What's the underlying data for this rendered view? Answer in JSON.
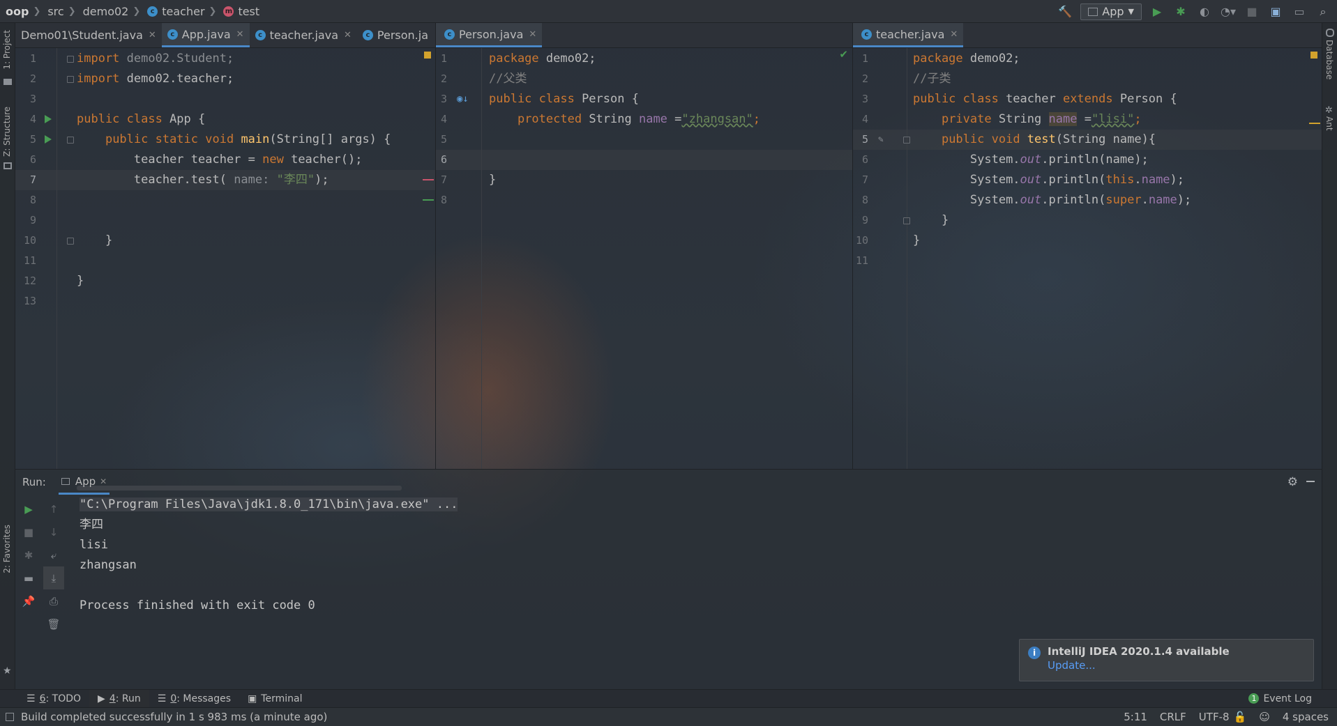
{
  "breadcrumb": [
    "oop",
    "src",
    "demo02",
    "teacher",
    "test"
  ],
  "toolbar": {
    "run_config": "App"
  },
  "left_strip": {
    "project": "1: Project",
    "structure": "Z: Structure",
    "favorites": "2: Favorites"
  },
  "right_strip": {
    "database": "Database",
    "ant": "Ant"
  },
  "left_tabs": [
    {
      "label": "Demo01\\Student.java",
      "active": false
    },
    {
      "label": "App.java",
      "active": true
    },
    {
      "label": "teacher.java",
      "active": false
    },
    {
      "label": "Person.ja",
      "active": false
    }
  ],
  "middle_tabs": [
    {
      "label": "Person.java",
      "active": true
    }
  ],
  "right_tabs": [
    {
      "label": "teacher.java",
      "active": true
    }
  ],
  "editor_app": {
    "line_numbers": [
      "1",
      "2",
      "3",
      "4",
      "5",
      "6",
      "7",
      "8",
      "9",
      "10",
      "11",
      "12",
      "13"
    ],
    "line1": {
      "kw": "import",
      "rest": " demo02.Student;"
    },
    "line2": {
      "kw": "import",
      "rest": " demo02.teacher;"
    },
    "line4": {
      "kw": "public class",
      "rest": " App {"
    },
    "line5": {
      "kw": "public static void",
      "fn": "main",
      "rest": "(String[] args) {"
    },
    "line6": {
      "a": "teacher teacher = ",
      "kw": "new",
      "b": " teacher();"
    },
    "line7": {
      "a": "teacher.test( ",
      "hint": "name:",
      "str": "\"李四\"",
      "b": ");"
    },
    "line10": "}",
    "line12": "}"
  },
  "editor_person": {
    "line_numbers": [
      "1",
      "2",
      "3",
      "4",
      "5",
      "6",
      "7",
      "8"
    ],
    "line1": {
      "kw": "package",
      "rest": " demo02;"
    },
    "line2": "//父类",
    "line3": {
      "kw": "public class",
      "rest": " Person {"
    },
    "line4": {
      "kw": "protected",
      "a": " String ",
      "fld": "name",
      "b": " =",
      "str": "\"zhangsan\"",
      "c": ";"
    },
    "line7": "}"
  },
  "editor_teacher": {
    "line_numbers": [
      "1",
      "2",
      "3",
      "4",
      "5",
      "6",
      "7",
      "8",
      "9",
      "10",
      "11"
    ],
    "line1": {
      "kw": "package",
      "rest": " demo02;"
    },
    "line2": "//子类",
    "line3": {
      "kw1": "public class",
      "a": " teacher ",
      "kw2": "extends",
      "b": " Person {"
    },
    "line4": {
      "kw": "private",
      "a": " String ",
      "fld": "name",
      "b": " =",
      "str": "\"lisi\"",
      "c": ";"
    },
    "line5": {
      "kw1": "public",
      "kw2": " void",
      "fn": " test",
      "rest": "(String name){"
    },
    "line6": {
      "a": "System.",
      "out": "out",
      "b": ".println(name);"
    },
    "line7": {
      "a": "System.",
      "out": "out",
      "b": ".println(",
      "kw": "this",
      "c": ".",
      "fld": "name",
      "d": ");"
    },
    "line8": {
      "a": "System.",
      "out": "out",
      "b": ".println(",
      "kw": "super",
      "c": ".",
      "fld": "name",
      "d": ");"
    },
    "line9": "}",
    "line10": "}"
  },
  "run_panel": {
    "label": "Run:",
    "tab": "App",
    "output": [
      "\"C:\\Program Files\\Java\\jdk1.8.0_171\\bin\\java.exe\" ...",
      "李四",
      "lisi",
      "zhangsan",
      "",
      "Process finished with exit code 0"
    ]
  },
  "notification": {
    "title": "IntelliJ IDEA 2020.1.4 available",
    "link": "Update..."
  },
  "tool_windows": [
    {
      "key": "6",
      "label": ": TODO"
    },
    {
      "key": "4",
      "label": ": Run"
    },
    {
      "key": "0",
      "label": ": Messages"
    },
    {
      "key": "",
      "label": "Terminal"
    }
  ],
  "event_log": {
    "count": "1",
    "label": "Event Log"
  },
  "status": {
    "message": "Build completed successfully in 1 s 983 ms (a minute ago)",
    "position": "5:11",
    "line_sep": "CRLF",
    "encoding": "UTF-8",
    "indent": "4 spaces"
  },
  "colors": {
    "keyword": "#cc7832",
    "string": "#6a8759",
    "field": "#9876aa",
    "function": "#ffc66d",
    "accent": "#4a88c7",
    "run_green": "#499c54"
  }
}
